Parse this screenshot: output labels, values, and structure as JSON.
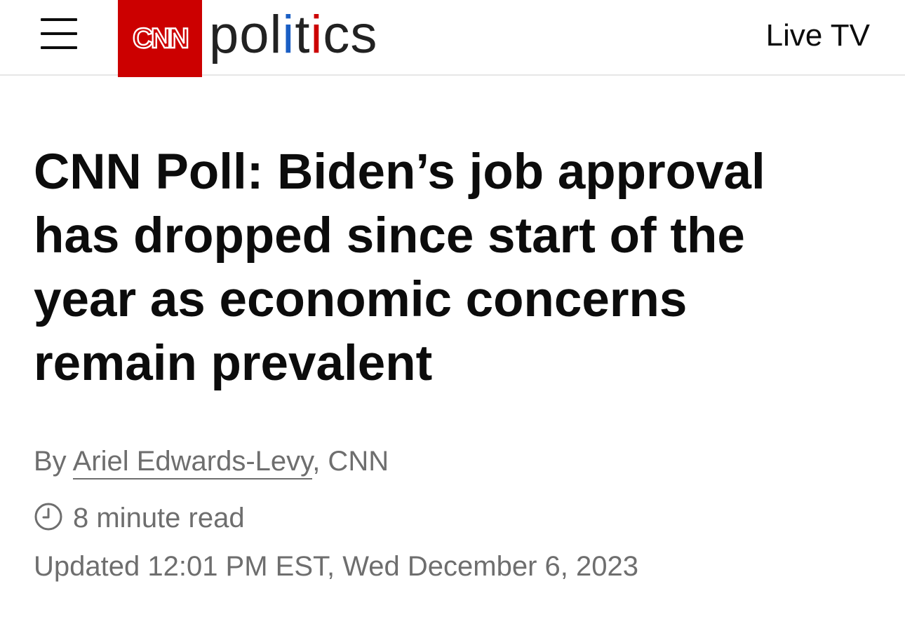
{
  "header": {
    "brand_logo_text": "CNN",
    "section_prefix": "pol",
    "section_i1": "i",
    "section_mid": "t",
    "section_i2": "i",
    "section_suffix": "cs",
    "live_tv_label": "Live TV",
    "brand_color": "#cc0000",
    "menu_icon": "hamburger-menu-icon"
  },
  "article": {
    "headline": "CNN Poll: Biden’s job approval has dropped since start of the year as economic concerns remain prevalent",
    "byline_prefix": "By ",
    "author": "Ariel Edwards-Levy",
    "byline_suffix": ", CNN",
    "read_time": "8 minute read",
    "clock_icon": "clock-icon",
    "updated": "Updated 12:01 PM EST, Wed December 6, 2023"
  }
}
